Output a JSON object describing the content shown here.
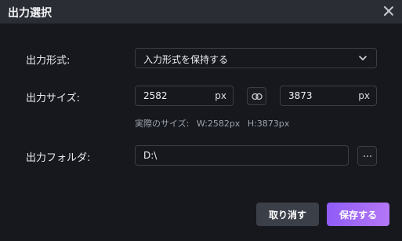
{
  "window": {
    "title": "出力選択"
  },
  "format": {
    "label": "出力形式:",
    "selected": "入力形式を保持する"
  },
  "size": {
    "label": "出力サイズ:",
    "width_value": "2582",
    "height_value": "3873",
    "unit": "px",
    "actual_label": "実際のサイズ:",
    "actual_width": "W:2582px",
    "actual_height": "H:3873px"
  },
  "folder": {
    "label": "出力フォルダ:",
    "path": "D:\\"
  },
  "buttons": {
    "cancel": "取り消す",
    "save": "保存する"
  },
  "icons": {
    "close": "close-icon",
    "dropdown": "chevron-down-icon",
    "link": "link-icon",
    "browse": "more-icon"
  },
  "colors": {
    "accent_start": "#8f5cf7",
    "accent_end": "#b477f6",
    "background": "#16181d",
    "titlebar": "#2a2d34"
  }
}
